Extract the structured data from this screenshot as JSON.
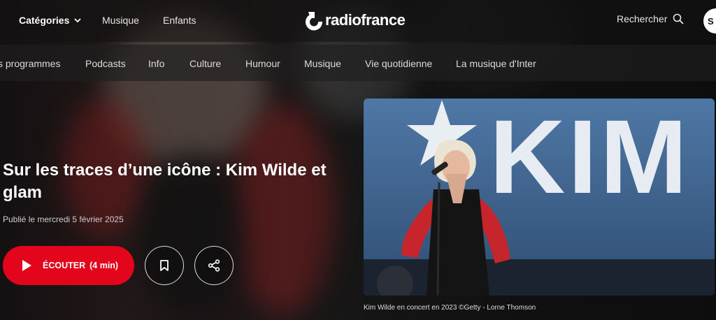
{
  "header": {
    "categories_label": "Catégories",
    "links": [
      "Musique",
      "Enfants"
    ],
    "logo_text": "radiofrance",
    "search_label": "Rechercher",
    "account_label": "S"
  },
  "nav": {
    "items": [
      "s programmes",
      "Podcasts",
      "Info",
      "Culture",
      "Humour",
      "Musique",
      "Vie quotidienne",
      "La musique d'Inter"
    ]
  },
  "article": {
    "title": "Sur les traces d’une icône : Kim Wilde et glam",
    "published": "Publié le mercredi 5 février 2025",
    "play_label": "ÉCOUTER",
    "duration": "(4 min)",
    "photo_caption": "Kim Wilde en concert en 2023 ©Getty - Lorne Thomson",
    "photo_banner_text": "KIM"
  },
  "colors": {
    "accent": "#e3051b",
    "background": "#161616",
    "photo_sky": "#3b5b82"
  },
  "icons": {
    "categories": "chevron-down-icon",
    "search": "search-icon",
    "play": "play-icon",
    "bookmark": "bookmark-icon",
    "share": "share-icon"
  }
}
